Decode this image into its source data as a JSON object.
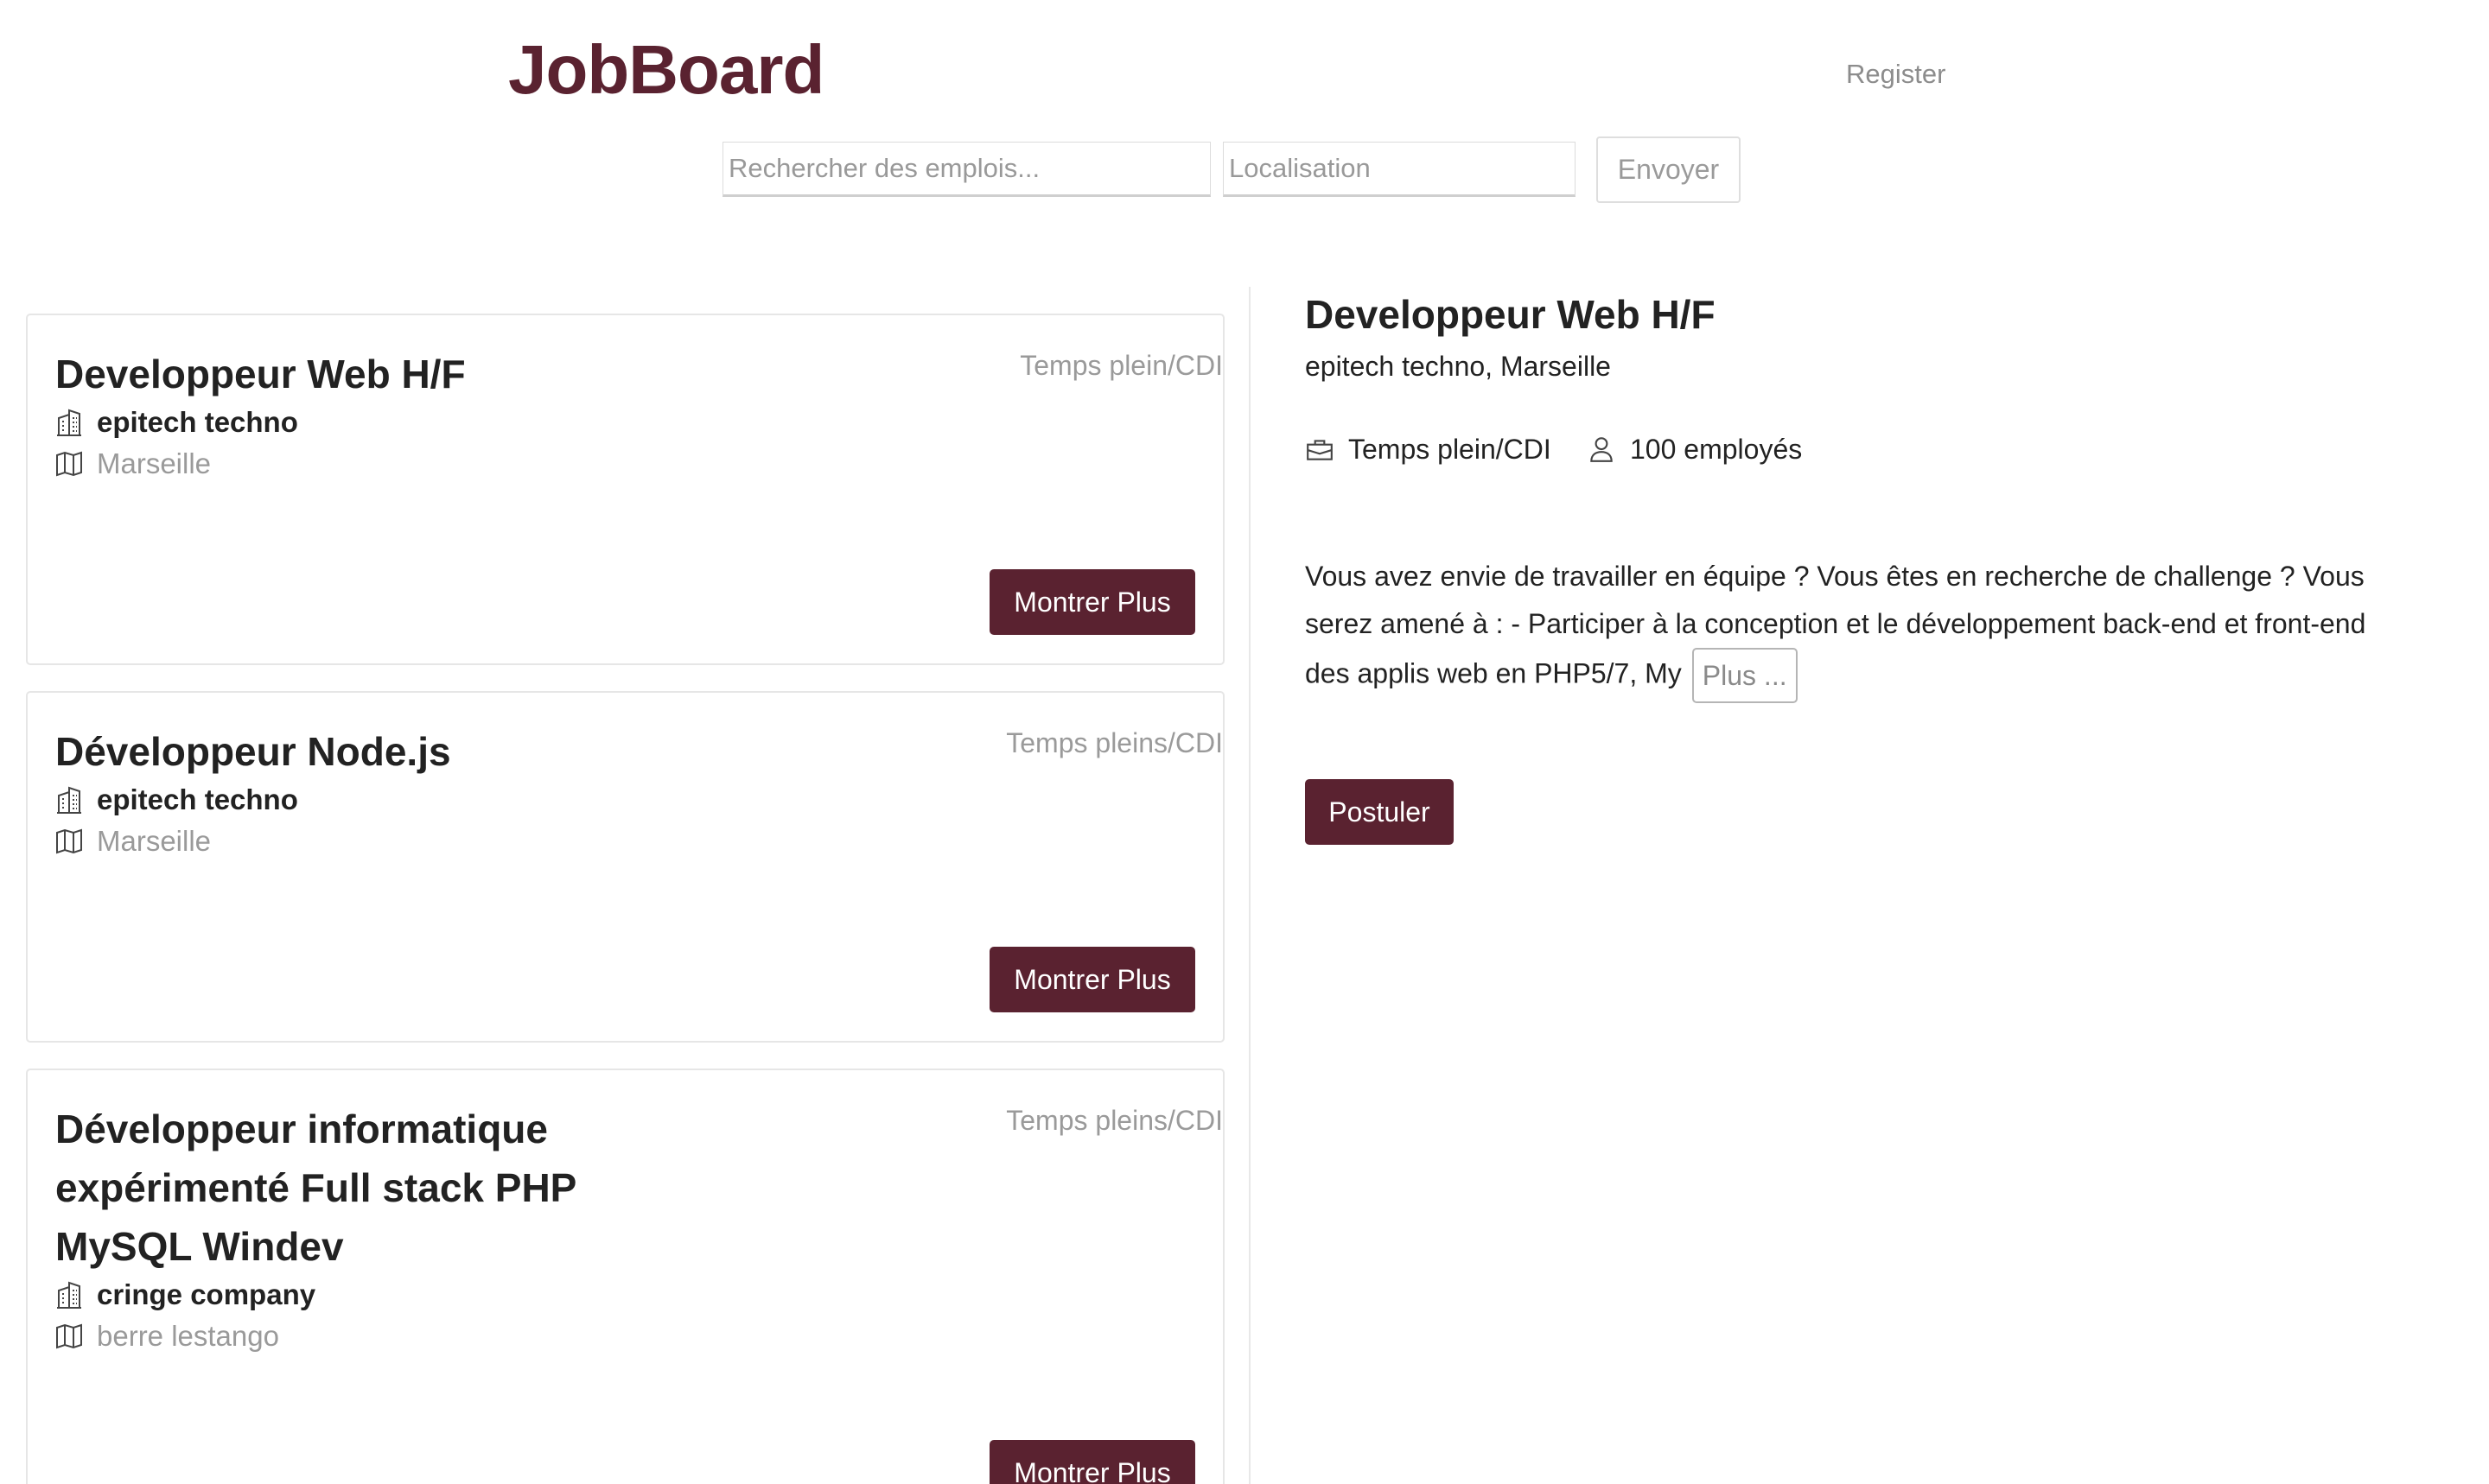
{
  "header": {
    "logo": "JobBoard",
    "register_label": "Register"
  },
  "search": {
    "keywords_placeholder": "Rechercher des emplois...",
    "location_placeholder": "Localisation",
    "submit_label": "Envoyer"
  },
  "jobs": [
    {
      "title": "Developpeur Web H/F",
      "contract": "Temps plein/CDI",
      "company": "epitech techno",
      "location": "Marseille",
      "button_label": "Montrer Plus"
    },
    {
      "title": "Développeur Node.js",
      "contract": "Temps pleins/CDI",
      "company": "epitech techno",
      "location": "Marseille",
      "button_label": "Montrer Plus"
    },
    {
      "title": "Développeur informatique expérimenté Full stack PHP MySQL Windev",
      "contract": "Temps pleins/CDI",
      "company": "cringe company",
      "location": "berre lestango",
      "button_label": "Montrer Plus"
    }
  ],
  "detail": {
    "title": "Developpeur Web H/F",
    "subtitle": "epitech techno, Marseille",
    "contract": "Temps plein/CDI",
    "employees": "100 employés",
    "description": "Vous avez envie de travailler en équipe ? Vous êtes en recherche de challenge ? Vous serez amené à : - Participer à la conception et le développement back-end et front-end des applis web en PHP5/7, My",
    "more_label": "Plus ...",
    "apply_label": "Postuler"
  },
  "icons": {
    "company": "building-icon",
    "location": "map-icon",
    "contract": "briefcase-icon",
    "employees": "person-icon"
  },
  "colors": {
    "brand": "#5a2230",
    "muted_text": "#9a9a9a",
    "border": "#e6e6e6"
  }
}
